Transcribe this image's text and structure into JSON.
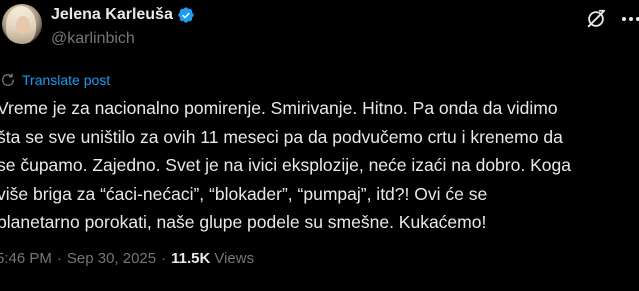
{
  "author": {
    "display_name": "Jelena Karleuša",
    "handle": "@karlinbich",
    "verified": true
  },
  "translate_label": "Translate post",
  "post_text": "Vreme je za nacionalno pomirenje. Smirivanje. Hitno. Pa onda da vidimo\nšta se sve uništilo za ovih 11 meseci pa da podvučemo crtu i krenemo da\nse čupamo. Zajedno. Svet je na ivici eksplozije, neće izaći na dobro. Koga\nviše briga za “ćaci-nećaci”, “blokader”, “pumpaj”, itd?! Ovi će se\nplanetarno porokati, naše glupe podele su smešne. Kukaćemo!",
  "meta": {
    "time": "5:46 PM",
    "separator": "·",
    "date": "Sep 30, 2025",
    "views_count": "11.5K",
    "views_label": "Views"
  },
  "icons": {
    "verified": "verified-badge-icon",
    "grok": "grok-icon",
    "more": "more-options-icon",
    "translate": "translate-icon"
  },
  "colors": {
    "background": "#000000",
    "text": "#e7e9ea",
    "secondary": "#71767b",
    "accent": "#1d9bf0"
  }
}
